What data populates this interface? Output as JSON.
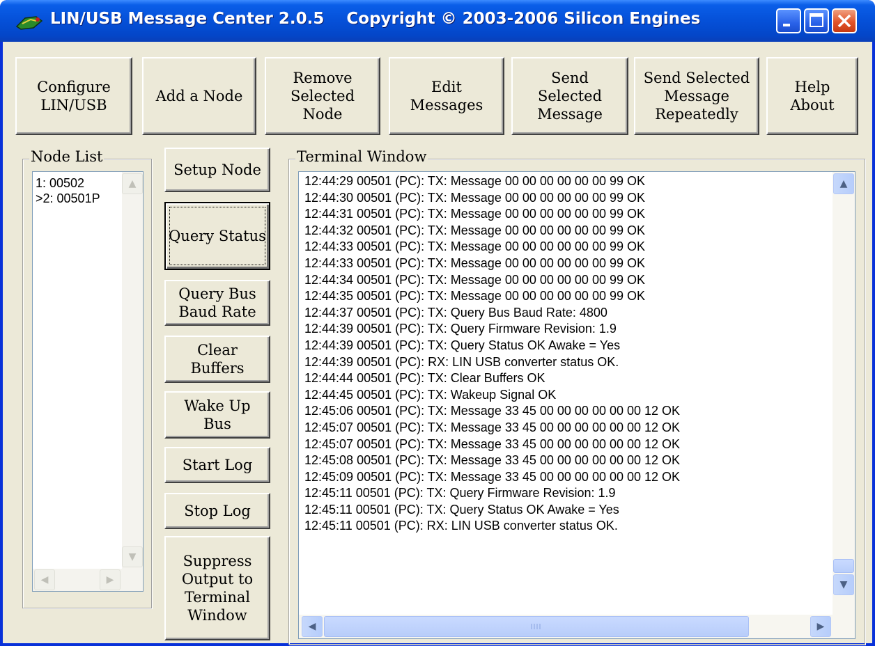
{
  "window": {
    "title": "LIN/USB Message Center 2.0.5    Copyright © 2003-2006 Silicon Engines",
    "controls": {
      "minimize": "minimize-icon",
      "maximize": "maximize-icon",
      "close": "close-icon"
    }
  },
  "toolbar": {
    "configure": "Configure\nLIN/USB",
    "add_node": "Add a Node",
    "remove_node": "Remove\nSelected\nNode",
    "edit_messages": "Edit\nMessages",
    "send_message": "Send\nSelected\nMessage",
    "send_repeatedly": "Send Selected\nMessage\nRepeatedly",
    "help_about": "Help\nAbout"
  },
  "node_list": {
    "label": "Node List",
    "items": [
      "1: 00502",
      ">2: 00501P"
    ]
  },
  "side_buttons": {
    "setup_node": "Setup Node",
    "query_status": "Query Status",
    "query_baud": "Query Bus\nBaud Rate",
    "clear_buffers": "Clear\nBuffers",
    "wake_up": "Wake Up\nBus",
    "start_log": "Start Log",
    "stop_log": "Stop Log",
    "suppress_output": "Suppress\nOutput to\nTerminal\nWindow"
  },
  "terminal": {
    "label": "Terminal Window",
    "lines": [
      "12:44:29 00501 (PC): TX: Message 00 00 00 00 00 00 99 OK",
      "12:44:30 00501 (PC): TX: Message 00 00 00 00 00 00 99 OK",
      "12:44:31 00501 (PC): TX: Message 00 00 00 00 00 00 99 OK",
      "12:44:32 00501 (PC): TX: Message 00 00 00 00 00 00 99 OK",
      "12:44:33 00501 (PC): TX: Message 00 00 00 00 00 00 99 OK",
      "12:44:33 00501 (PC): TX: Message 00 00 00 00 00 00 99 OK",
      "12:44:34 00501 (PC): TX: Message 00 00 00 00 00 00 99 OK",
      "12:44:35 00501 (PC): TX: Message 00 00 00 00 00 00 99 OK",
      "12:44:37 00501 (PC): TX: Query Bus Baud Rate: 4800",
      "12:44:39 00501 (PC): TX: Query Firmware Revision: 1.9",
      "12:44:39 00501 (PC): TX: Query Status OK Awake = Yes",
      "12:44:39 00501 (PC): RX: LIN USB converter status OK.",
      "12:44:44 00501 (PC): TX: Clear Buffers OK",
      "12:44:45 00501 (PC): TX: Wakeup Signal OK",
      "12:45:06 00501 (PC): TX: Message 33 45 00 00 00 00 00 00 12 OK",
      "12:45:07 00501 (PC): TX: Message 33 45 00 00 00 00 00 00 12 OK",
      "12:45:07 00501 (PC): TX: Message 33 45 00 00 00 00 00 00 12 OK",
      "12:45:08 00501 (PC): TX: Message 33 45 00 00 00 00 00 00 12 OK",
      "12:45:09 00501 (PC): TX: Message 33 45 00 00 00 00 00 00 12 OK",
      "12:45:11 00501 (PC): TX: Query Firmware Revision: 1.9",
      "12:45:11 00501 (PC): TX: Query Status OK Awake = Yes",
      "12:45:11 00501 (PC): RX: LIN USB converter status OK."
    ]
  },
  "colors": {
    "titlebar": "#0550d8",
    "client": "#ece9d8",
    "scroll_accent": "#b6cdfb"
  }
}
